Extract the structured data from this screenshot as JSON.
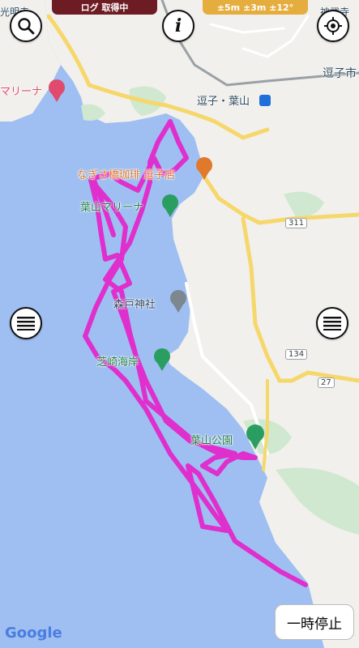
{
  "status": {
    "log_label": "ログ 取得中",
    "accuracy_label": "±5m ±3m ±12°"
  },
  "map": {
    "labels": {
      "city_zushi": "逗子市",
      "kozo_temple": "光明寺",
      "jinmuji": "神武寺",
      "marina_left": "マリーナ",
      "station": "逗子・葉山",
      "cafe": "なぎさ橋珈琲 逗子店",
      "hayama_marina": "葉山マリーナ",
      "morito_shrine": "森戸神社",
      "shibasaki": "芝崎海岸",
      "hayama_park": "葉山公園"
    },
    "route_numbers": [
      "311",
      "134",
      "27"
    ],
    "attribution": "Google"
  },
  "controls": {
    "search_icon": "search-icon",
    "info_icon": "info-icon",
    "locate_icon": "locate-icon",
    "menu_icon": "menu-icon",
    "info_glyph": "i",
    "pause_label": "一時停止"
  },
  "colors": {
    "water": "#9fbff2",
    "land": "#f1f0ec",
    "track": "#df2fcc",
    "road": "#f6d76b"
  }
}
